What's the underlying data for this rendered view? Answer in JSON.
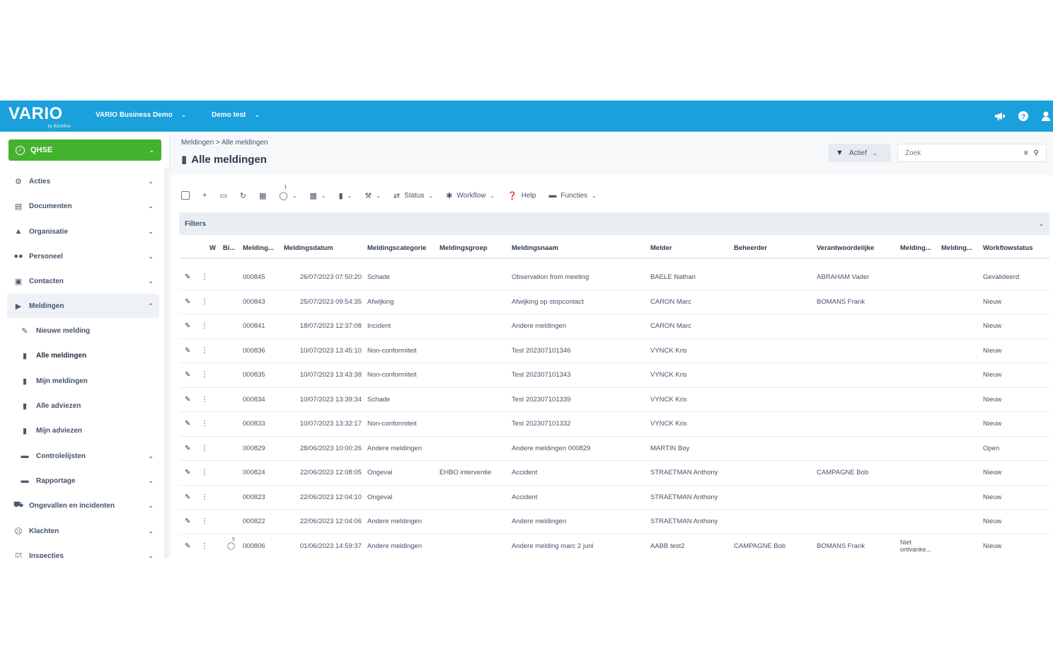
{
  "header": {
    "logo": "VARIO",
    "logo_sub": "by BizzMine",
    "environment": "VARIO Business Demo",
    "workspace": "Demo test",
    "icons": [
      "megaphone-icon",
      "help-icon",
      "user-icon"
    ]
  },
  "sidebar": {
    "module": "QHSE",
    "items": [
      {
        "label": "Acties",
        "icon": "sitemap-icon"
      },
      {
        "label": "Documenten",
        "icon": "book-icon"
      },
      {
        "label": "Organisatie",
        "icon": "org-icon"
      },
      {
        "label": "Personeel",
        "icon": "users-icon"
      },
      {
        "label": "Contacten",
        "icon": "address-book-icon"
      },
      {
        "label": "Meldingen",
        "icon": "megaphone-icon"
      }
    ],
    "subitems": [
      {
        "label": "Nieuwe melding",
        "icon": "pencil-icon"
      },
      {
        "label": "Alle meldingen",
        "icon": "file-icon"
      },
      {
        "label": "Mijn meldingen",
        "icon": "file-icon"
      },
      {
        "label": "Alle adviezen",
        "icon": "file-icon"
      },
      {
        "label": "Mijn adviezen",
        "icon": "file-icon"
      },
      {
        "label": "Controlelijsten",
        "icon": "folder-icon"
      },
      {
        "label": "Rapportage",
        "icon": "folder-icon"
      }
    ],
    "more_items": [
      {
        "label": "Ongevallen en incidenten",
        "icon": "ambulance-icon"
      },
      {
        "label": "Klachten",
        "icon": "frown-icon"
      },
      {
        "label": "Inspecties",
        "icon": "check-square-icon"
      }
    ]
  },
  "page": {
    "breadcrumb": "Meldingen > Alle meldingen",
    "title": "Alle meldingen",
    "filter_active": "Actief",
    "search_placeholder": "Zoek"
  },
  "toolbar": {
    "attach_count": "1",
    "status": "Status",
    "workflow": "Workflow",
    "help": "Help",
    "functies": "Functies"
  },
  "filters_label": "Filters",
  "table": {
    "columns": [
      "W",
      "Bi...",
      "Melding...",
      "Meldingsdatum",
      "Meldingscategorie",
      "Meldingsgroep",
      "Meldingsnaam",
      "Melder",
      "Beheerder",
      "Verantwoordelijke",
      "Melding...",
      "Melding...",
      "Workflowstatus"
    ],
    "rows": [
      {
        "id": "000845",
        "date": "26/07/2023 07:50:20",
        "cat": "Schade",
        "group": "",
        "name": "Observation from meeting",
        "melder": "BAELE Nathan",
        "beheerder": "",
        "verantw": "ABRAHAM Vader",
        "m1": "",
        "m2": "",
        "status": "Gevalideerd",
        "att": ""
      },
      {
        "id": "000843",
        "date": "25/07/2023 09:54:35",
        "cat": "Afwijking",
        "group": "",
        "name": "Afwijking op stopcontact",
        "melder": "CARON Marc",
        "beheerder": "",
        "verantw": "BOMANS Frank",
        "m1": "",
        "m2": "",
        "status": "Nieuw",
        "att": ""
      },
      {
        "id": "000841",
        "date": "18/07/2023 12:37:08",
        "cat": "Incident",
        "group": "",
        "name": "Andere meldingen",
        "melder": "CARON Marc",
        "beheerder": "",
        "verantw": "",
        "m1": "",
        "m2": "",
        "status": "Nieuw",
        "att": ""
      },
      {
        "id": "000836",
        "date": "10/07/2023 13:45:10",
        "cat": "Non-conformiteit",
        "group": "",
        "name": "Test 202307101346",
        "melder": "VYNCK Kris",
        "beheerder": "",
        "verantw": "",
        "m1": "",
        "m2": "",
        "status": "Nieuw",
        "att": ""
      },
      {
        "id": "000835",
        "date": "10/07/2023 13:43:38",
        "cat": "Non-conformiteit",
        "group": "",
        "name": "Test 202307101343",
        "melder": "VYNCK Kris",
        "beheerder": "",
        "verantw": "",
        "m1": "",
        "m2": "",
        "status": "Nieuw",
        "att": ""
      },
      {
        "id": "000834",
        "date": "10/07/2023 13:39:34",
        "cat": "Schade",
        "group": "",
        "name": "Test 202307101339",
        "melder": "VYNCK Kris",
        "beheerder": "",
        "verantw": "",
        "m1": "",
        "m2": "",
        "status": "Nieuw",
        "att": ""
      },
      {
        "id": "000833",
        "date": "10/07/2023 13:32:17",
        "cat": "Non-conformiteit",
        "group": "",
        "name": "Test 202307101332",
        "melder": "VYNCK Kris",
        "beheerder": "",
        "verantw": "",
        "m1": "",
        "m2": "",
        "status": "Nieuw",
        "att": ""
      },
      {
        "id": "000829",
        "date": "28/06/2023 10:00:26",
        "cat": "Andere meldingen",
        "group": "",
        "name": "Andere meldingen 000829",
        "melder": "MARTIN Boy",
        "beheerder": "",
        "verantw": "",
        "m1": "",
        "m2": "",
        "status": "Open",
        "att": ""
      },
      {
        "id": "000824",
        "date": "22/06/2023 12:08:05",
        "cat": "Ongeval",
        "group": "EHBO interventie",
        "name": "Accident",
        "melder": "STRAETMAN Anthony",
        "beheerder": "",
        "verantw": "CAMPAGNE Bob",
        "m1": "",
        "m2": "",
        "status": "Nieuw",
        "att": ""
      },
      {
        "id": "000823",
        "date": "22/06/2023 12:04:10",
        "cat": "Ongeval",
        "group": "",
        "name": "Accident",
        "melder": "STRAETMAN Anthony",
        "beheerder": "",
        "verantw": "",
        "m1": "",
        "m2": "",
        "status": "Nieuw",
        "att": ""
      },
      {
        "id": "000822",
        "date": "22/06/2023 12:04:06",
        "cat": "Andere meldingen",
        "group": "",
        "name": "Andere meldingen",
        "melder": "STRAETMAN Anthony",
        "beheerder": "",
        "verantw": "",
        "m1": "",
        "m2": "",
        "status": "Nieuw",
        "att": ""
      },
      {
        "id": "000806",
        "date": "01/06/2023 14:59:37",
        "cat": "Andere meldingen",
        "group": "",
        "name": "Andere melding marc 2 juni",
        "melder": "AABB test2",
        "beheerder": "CAMPAGNE Bob",
        "verantw": "BOMANS Frank",
        "m1": "Niet ontvanke...",
        "m2": "",
        "status": "Nieuw",
        "att": "5"
      }
    ]
  },
  "colors": {
    "topbar": "#1aa0db",
    "qhse": "#44b22d"
  }
}
